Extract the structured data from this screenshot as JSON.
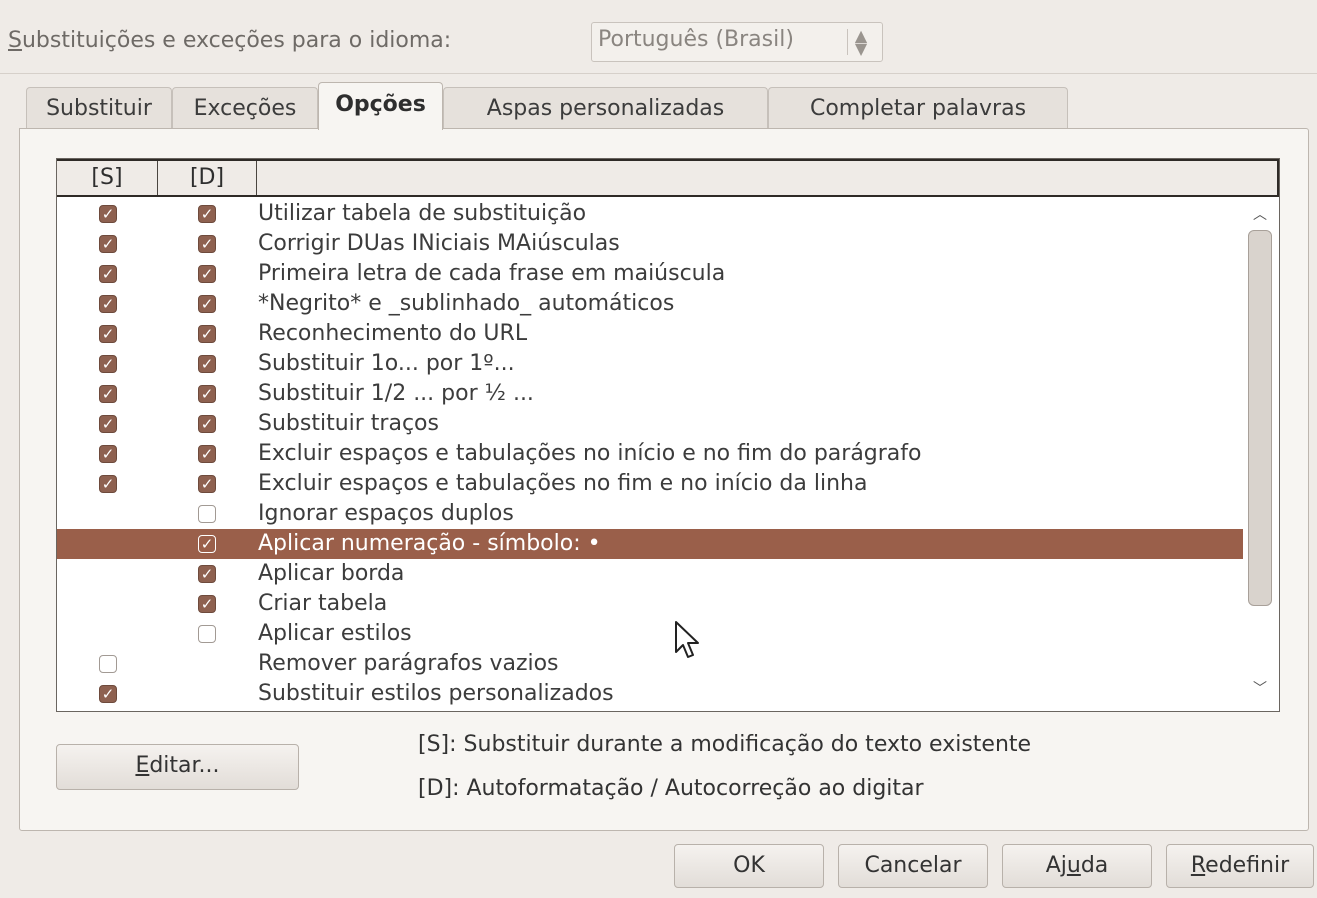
{
  "language_row": {
    "label_u": "S",
    "label_rest": "ubstituições e exceções para o idioma:",
    "selected_language": "Português (Brasil)",
    "spin_icon": "up-down-spin-icon"
  },
  "tabs": [
    {
      "label": "Substituir",
      "active": false
    },
    {
      "label": "Exceções",
      "active": false
    },
    {
      "label": "Opções",
      "active": true
    },
    {
      "label": "Aspas personalizadas",
      "active": false
    },
    {
      "label": "Completar palavras",
      "active": false
    }
  ],
  "table": {
    "col_s": "[S]",
    "col_d": "[D]",
    "col_text": "",
    "rows": [
      {
        "label": "Utilizar tabela de substituição",
        "s": true,
        "d": true
      },
      {
        "label": "Corrigir DUas INiciais MAiúsculas",
        "s": true,
        "d": true
      },
      {
        "label": "Primeira letra de cada frase em maiúscula",
        "s": true,
        "d": true
      },
      {
        "label": "*Negrito* e _sublinhado_ automáticos",
        "s": true,
        "d": true
      },
      {
        "label": "Reconhecimento do URL",
        "s": true,
        "d": true
      },
      {
        "label": "Substituir 1o... por 1º...",
        "s": true,
        "d": true
      },
      {
        "label": "Substituir 1/2 ... por ½ ...",
        "s": true,
        "d": true
      },
      {
        "label": "Substituir traços",
        "s": true,
        "d": true
      },
      {
        "label": "Excluir espaços e tabulações no início e no fim do parágrafo",
        "s": true,
        "d": true
      },
      {
        "label": "Excluir espaços e tabulações no fim e no início da linha",
        "s": true,
        "d": true
      },
      {
        "label": "Ignorar espaços duplos",
        "s": null,
        "d": false
      },
      {
        "label": "Aplicar numeração - símbolo: •",
        "s": null,
        "d": true,
        "selected": true
      },
      {
        "label": "Aplicar borda",
        "s": null,
        "d": true
      },
      {
        "label": "Criar tabela",
        "s": null,
        "d": true
      },
      {
        "label": "Aplicar estilos",
        "s": null,
        "d": false
      },
      {
        "label": "Remover parágrafos vazios",
        "s": false,
        "d": null
      },
      {
        "label": "Substituir estilos personalizados",
        "s": true,
        "d": null
      }
    ]
  },
  "scrollbar": {
    "up_icon": "scroll-up-icon",
    "down_icon": "scroll-down-icon"
  },
  "edit_button": {
    "u": "E",
    "rest": "ditar..."
  },
  "notes": {
    "s_note": "[S]: Substituir durante a modificação do texto existente",
    "d_note": "[D]: Autoformatação / Autocorreção ao digitar"
  },
  "buttons": {
    "ok": "OK",
    "cancel": "Cancelar",
    "help_pre": "Aj",
    "help_u": "u",
    "help_post": "da",
    "reset_u": "R",
    "reset_rest": "edefinir"
  },
  "colors": {
    "accent_selection": "#9a5f4a",
    "checkbox_on": "#8e6150",
    "window_bg": "#efebe7"
  }
}
